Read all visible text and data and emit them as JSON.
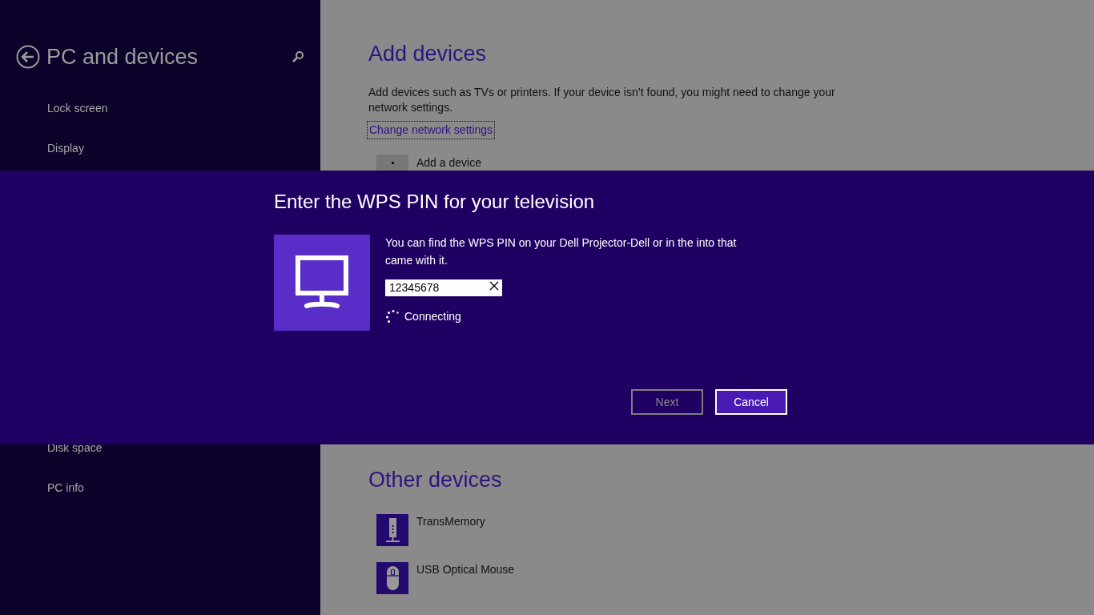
{
  "sidebar": {
    "title": "PC and devices",
    "items": [
      {
        "label": "Lock screen"
      },
      {
        "label": "Display"
      },
      {
        "label": "Disk space"
      },
      {
        "label": "PC info"
      }
    ]
  },
  "add_devices": {
    "title": "Add devices",
    "description": "Add devices such as TVs or printers. If your device isn’t found, you might need to change your network settings.",
    "link": {
      "label": "Change network settings",
      "focused": true
    },
    "add_button": "Add a device"
  },
  "other_devices": {
    "title": "Other devices",
    "devices": [
      {
        "name": "TransMemory",
        "kind": "drive"
      },
      {
        "name": "USB Optical Mouse",
        "kind": "mouse"
      }
    ]
  },
  "dialog": {
    "title": "Enter the WPS PIN for your television",
    "message": "You can find the WPS PIN on your Dell Projector-Dell or in the into that came with it.",
    "pin": "12345678",
    "status": "Connecting",
    "buttons": [
      {
        "label": "Next",
        "disabled": true
      },
      {
        "label": "Cancel",
        "disabled": false
      }
    ]
  }
}
